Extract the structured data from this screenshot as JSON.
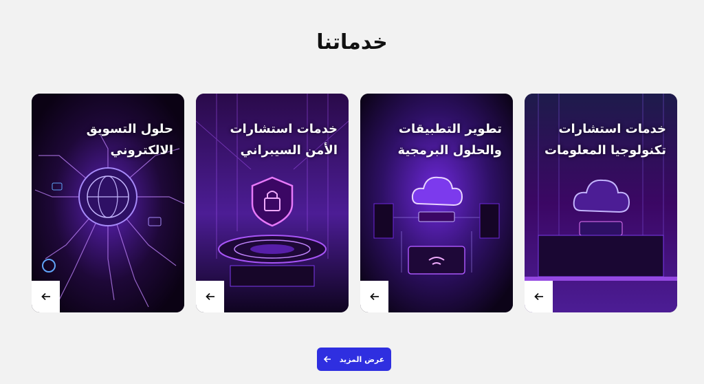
{
  "section": {
    "title": "خدماتنا"
  },
  "cards": [
    {
      "title_line1": "خدمات استشارات",
      "title_line2": "تكنولوجيا المعلومات"
    },
    {
      "title_line1": "تطوير التطبيقات",
      "title_line2": "والحلول البرمجية"
    },
    {
      "title_line1": "خدمات استشارات",
      "title_line2": "الأمن السيبراني"
    },
    {
      "title_line1": "حلول التسويق",
      "title_line2": "الالكتروني"
    }
  ],
  "card_icons": [
    "cloud-server-icon",
    "cloud-chip-icon",
    "shield-lock-icon",
    "globe-network-icon"
  ],
  "more_button": {
    "label": "عرض المزيد",
    "icon": "arrow-left-icon"
  },
  "colors": {
    "accent": "#2f2fe0",
    "card_bg": "#12051f",
    "glow": "#a855f7",
    "page_bg": "#f2f2f2"
  }
}
